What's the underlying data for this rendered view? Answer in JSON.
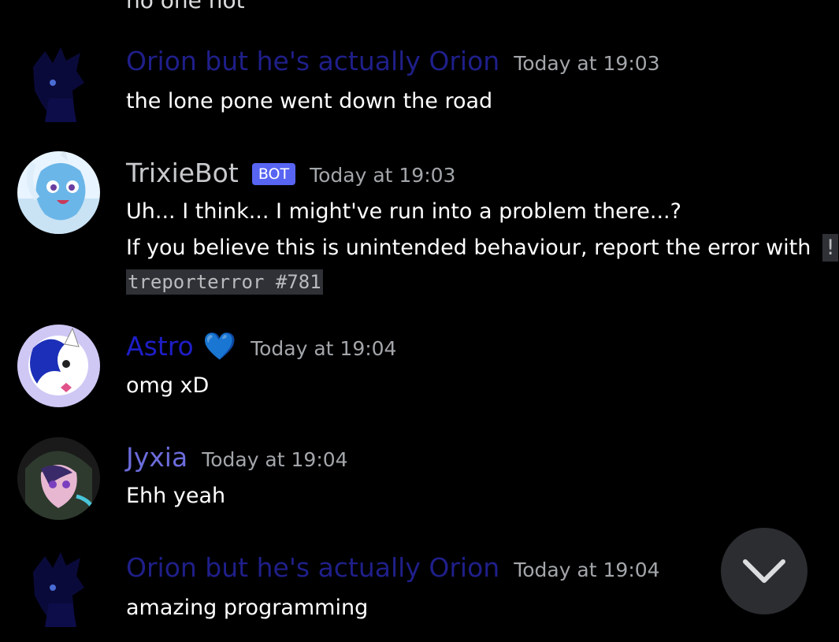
{
  "partial_top_text": "no one not",
  "messages": [
    {
      "username": "Orion but he's actually Orion",
      "timestamp": "Today at 19:03",
      "lines": [
        "the lone pone went down the road"
      ]
    },
    {
      "username": "TrixieBot",
      "bot_tag": "BOT",
      "timestamp": "Today at 19:03",
      "lines": [
        "Uh... I think... I might've run into a problem there...?",
        "If you believe this is unintended behaviour, report the error with"
      ],
      "code_part1": "!",
      "code_part2": "treporterror #781"
    },
    {
      "username": "Astro",
      "emoji": "💙",
      "timestamp": "Today at 19:04",
      "lines": [
        "omg xD"
      ]
    },
    {
      "username": "Jyxia",
      "timestamp": "Today at 19:04",
      "lines": [
        "Ehh yeah"
      ]
    },
    {
      "username": "Orion but he's actually Orion",
      "timestamp": "Today at 19:04",
      "lines": [
        "amazing programming"
      ]
    }
  ],
  "colors": {
    "orion_name": "#1f1f8a",
    "trixie_name": "#c7c9cc",
    "astro_name": "#1e1ec8",
    "jyxia_name": "#6c6cdc",
    "bot_tag_bg": "#5865f2",
    "background": "#000000"
  },
  "jump_button": {
    "icon": "chevron-down-icon"
  }
}
